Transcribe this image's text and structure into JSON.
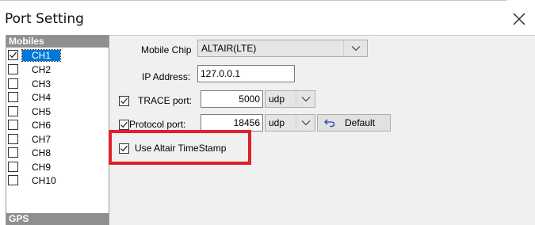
{
  "window": {
    "title": "Port Setting",
    "close_icon": "close-icon"
  },
  "sidebar": {
    "groups": [
      {
        "label": "Mobiles"
      },
      {
        "label": "GPS"
      }
    ],
    "channels": [
      {
        "label": "CH1",
        "checked": true,
        "selected": true
      },
      {
        "label": "CH2",
        "checked": false,
        "selected": false
      },
      {
        "label": "CH3",
        "checked": false,
        "selected": false
      },
      {
        "label": "CH4",
        "checked": false,
        "selected": false
      },
      {
        "label": "CH5",
        "checked": false,
        "selected": false
      },
      {
        "label": "CH6",
        "checked": false,
        "selected": false
      },
      {
        "label": "CH7",
        "checked": false,
        "selected": false
      },
      {
        "label": "CH8",
        "checked": false,
        "selected": false
      },
      {
        "label": "CH9",
        "checked": false,
        "selected": false
      },
      {
        "label": "CH10",
        "checked": false,
        "selected": false
      }
    ]
  },
  "settings": {
    "mobile_chip": {
      "label": "Mobile Chip",
      "value": "ALTAIR(LTE)"
    },
    "ip_address": {
      "label": "IP Address:",
      "value": "127.0.0.1"
    },
    "trace_port": {
      "label": "TRACE port:",
      "checked": true,
      "value": "5000",
      "protocol": "udp"
    },
    "protocol_port": {
      "label": "Protocol port:",
      "checked": true,
      "value": "18456",
      "protocol": "udp"
    },
    "default_button": {
      "label": "Default",
      "icon": "undo-icon"
    },
    "use_altair_timestamp": {
      "label": "Use Altair TimeStamp",
      "checked": true
    }
  },
  "colors": {
    "selection": "#0078d7",
    "group_header": "#8f8f8f",
    "highlight": "#e0202a",
    "panel_bg": "#f0f0f0"
  }
}
